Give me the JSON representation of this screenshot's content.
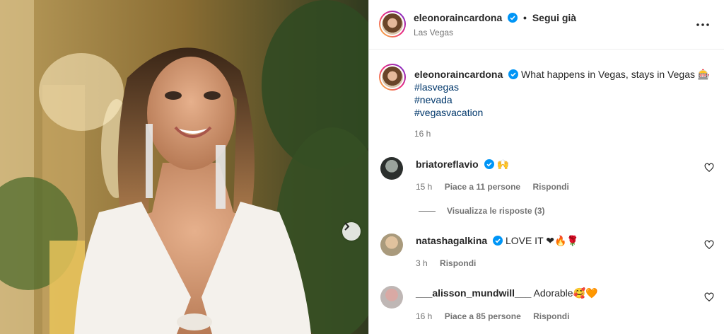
{
  "post": {
    "username": "eleonoraincardona",
    "follow_label": "Segui già",
    "dot": "•",
    "location": "Las Vegas",
    "caption_text": "What happens in Vegas, stays in Vegas 🎰",
    "hashtags": [
      "#lasvegas",
      "#nevada",
      "#vegasvacation"
    ],
    "time": "16 h"
  },
  "comments": [
    {
      "username": "briatoreflavio",
      "text": "🙌",
      "time": "15 h",
      "likes": "Piace a 11 persone",
      "reply": "Rispondi",
      "verified": true
    },
    {
      "username": "natashagalkina",
      "text": "LOVE IT ❤🔥🌹",
      "time": "3 h",
      "reply": "Rispondi",
      "verified": true
    },
    {
      "username": "___alisson_mundwill___",
      "text": "Adorable🥰🧡",
      "time": "16 h",
      "likes": "Piace a 85 persone",
      "reply": "Rispondi",
      "verified": false
    }
  ],
  "view_replies": "Visualizza le risposte (3)",
  "colors": {
    "verified": "#0095f6",
    "hashtag": "#00376b",
    "secondary_text": "#737373"
  },
  "icons": [
    "verified-badge-icon",
    "more-options-icon",
    "heart-icon",
    "chevron-right-icon"
  ]
}
